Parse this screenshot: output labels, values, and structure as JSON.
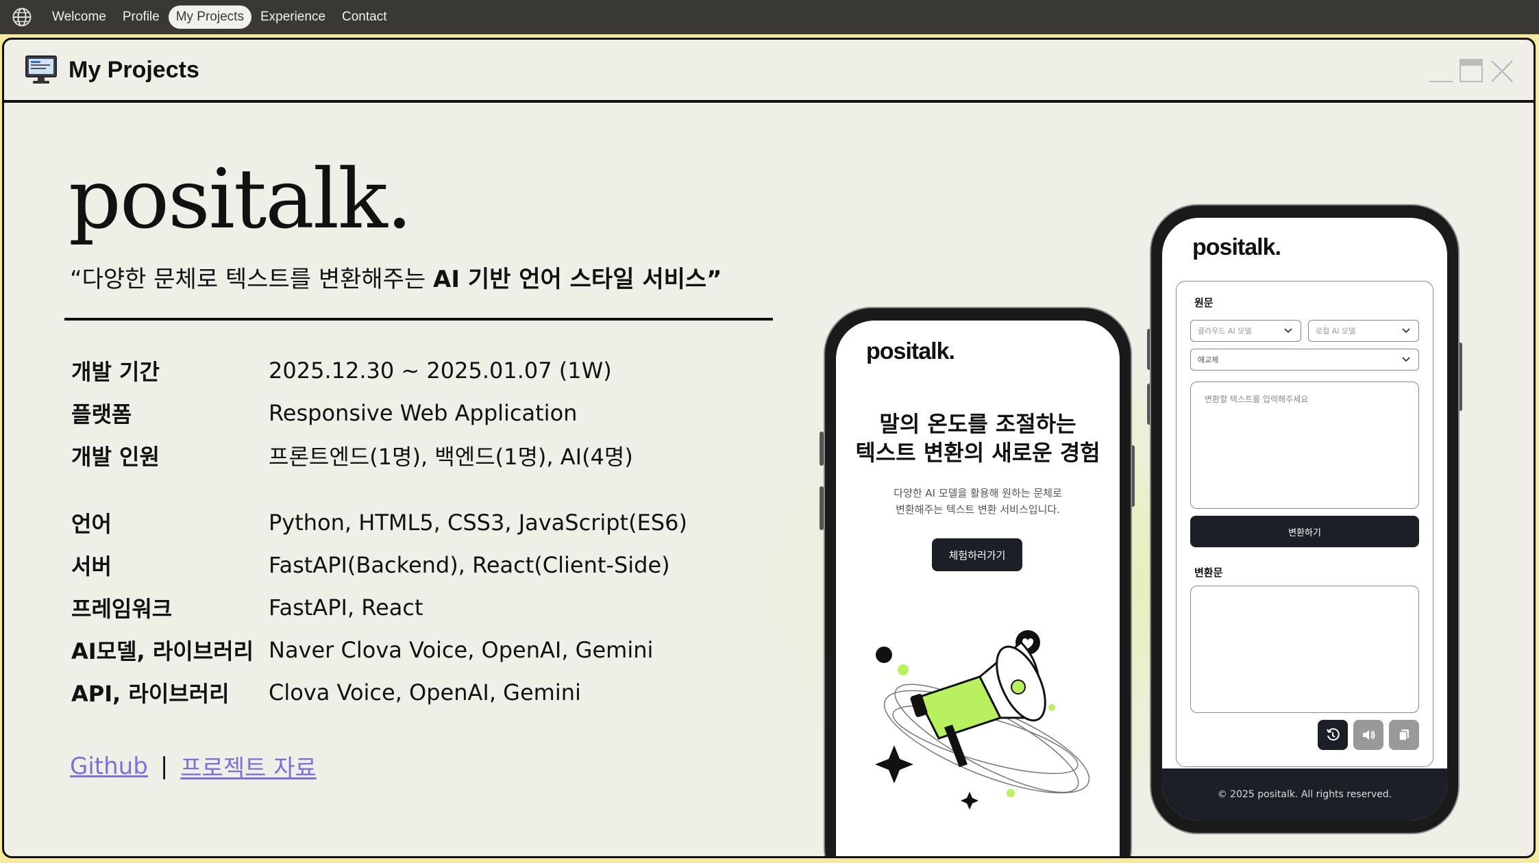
{
  "taskbar": {
    "icon": "globe-icon",
    "nav": [
      "Welcome",
      "Profile",
      "My Projects",
      "Experience",
      "Contact"
    ],
    "active": "My Projects"
  },
  "window": {
    "title": "My Projects",
    "icon": "monitor-icon",
    "controls": [
      "minimize-icon",
      "maximize-icon",
      "close-icon"
    ]
  },
  "project": {
    "name": "positalk.",
    "tagline_pre": "“다양한 문체로 텍스트를 변환해주는 ",
    "tagline_bold": "AI 기반 언어 스타일 서비스”",
    "info": [
      {
        "label": "개발 기간",
        "value": "2025.12.30 ~ 2025.01.07 (1W)"
      },
      {
        "label": "플랫폼",
        "value": "Responsive Web Application"
      },
      {
        "label": "개발 인원",
        "value": "프론트엔드(1명), 백엔드(1명), AI(4명)"
      },
      {
        "label": "언어",
        "value": "Python, HTML5, CSS3, JavaScript(ES6)"
      },
      {
        "label": "서버",
        "value": "FastAPI(Backend), React(Client-Side)"
      },
      {
        "label": "프레임워크",
        "value": "FastAPI, React"
      },
      {
        "label": "AI모델, 라이브러리",
        "value": "Naver Clova Voice, OpenAI, Gemini"
      },
      {
        "label": "API, 라이브러리",
        "value": "Clova Voice, OpenAI, Gemini"
      }
    ],
    "links": {
      "github": "Github",
      "separator": "|",
      "docs": "프로젝트 자료"
    }
  },
  "phone_landing": {
    "logo": "positalk.",
    "headline_1": "말의 온도를 조절하는",
    "headline_2": "텍스트 변환의 새로운 경험",
    "sub_1": "다양한 AI 모델을 활용해 원하는 문체로",
    "sub_2": "변환해주는 텍스트 변환 서비스입니다.",
    "cta": "체험하러가기",
    "illustration": "megaphone-icon"
  },
  "phone_app": {
    "logo": "positalk.",
    "source_label": "원문",
    "cloud_model_placeholder": "클라우드 AI 모델",
    "local_model_placeholder": "로컬 AI 모델",
    "style_placeholder": "애교체",
    "input_placeholder": "변환할 텍스트를 입력해주세요",
    "convert_label": "변환하기",
    "result_label": "변환문",
    "actions": [
      "history-icon",
      "speaker-icon",
      "copy-icon"
    ],
    "footer": "© 2025 positalk. All rights reserved."
  },
  "colors": {
    "taskbar": "#3a3833",
    "window_bg": "#efefe8",
    "accent_green": "#b8f060",
    "link": "#7a72d6",
    "dark_button": "#1d1f26"
  }
}
